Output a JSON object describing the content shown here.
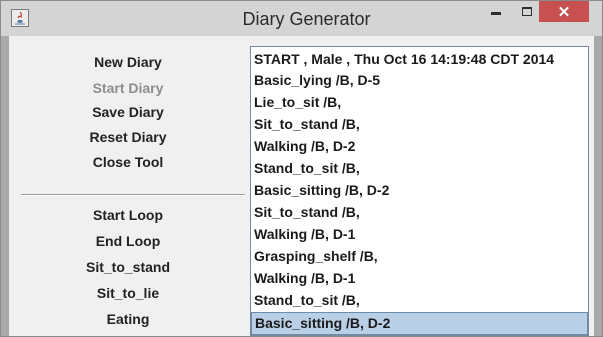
{
  "window": {
    "title": "Diary Generator",
    "close_glyph": "✕",
    "icon": "java-app-icon"
  },
  "left_menu": {
    "top_buttons": [
      {
        "label": "New Diary",
        "enabled": true
      },
      {
        "label": "Start Diary",
        "enabled": false
      },
      {
        "label": "Save Diary",
        "enabled": true
      },
      {
        "label": "Reset Diary",
        "enabled": true
      },
      {
        "label": "Close Tool",
        "enabled": true
      }
    ],
    "bottom_buttons": [
      {
        "label": "Start Loop"
      },
      {
        "label": "End Loop"
      },
      {
        "label": "Sit_to_stand"
      },
      {
        "label": "Sit_to_lie"
      },
      {
        "label": "Eating"
      }
    ]
  },
  "diary_list": {
    "items": [
      "START , Male , Thu Oct 16 14:19:48 CDT 2014",
      "Basic_lying /B, D-5",
      "Lie_to_sit /B,",
      "Sit_to_stand /B,",
      "Walking /B, D-2",
      "Stand_to_sit /B,",
      "Basic_sitting /B, D-2",
      "Sit_to_stand /B,",
      "Walking /B, D-1",
      "Grasping_shelf /B,",
      "Walking /B, D-1",
      "Stand_to_sit /B,",
      "Basic_sitting /B, D-2"
    ],
    "selected_index": 12
  },
  "colors": {
    "close_button": "#c75050",
    "selection": "#b9cfe6"
  }
}
